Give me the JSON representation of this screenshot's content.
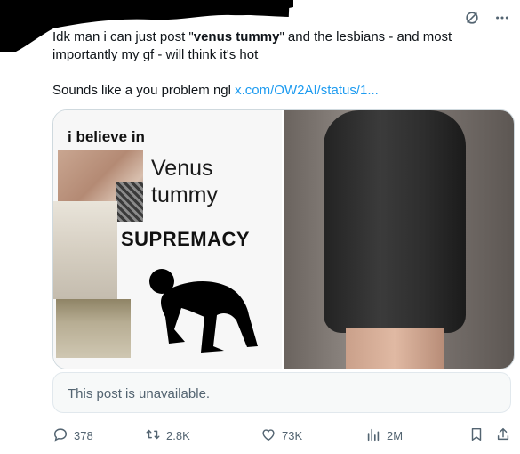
{
  "post": {
    "line1_pre": "Idk man i can just post \"",
    "line1_bold": "venus tummy",
    "line1_post": "\" and the lesbians - and most importantly my gf - will think it's hot",
    "line2_text": "Sounds like a you problem ngl ",
    "line2_link": "x.com/OW2AI/status/1..."
  },
  "meme": {
    "believe": "i believe in",
    "venus": "Venus",
    "tummy": "tummy",
    "supremacy": "SUPREMACY"
  },
  "quoted": {
    "unavailable": "This post is unavailable."
  },
  "actions": {
    "replies": "378",
    "reposts": "2.8K",
    "likes": "73K",
    "views": "2M"
  },
  "icons": [
    "grok-icon",
    "more-icon",
    "reply-icon",
    "repost-icon",
    "like-icon",
    "views-icon",
    "bookmark-icon",
    "share-icon"
  ]
}
